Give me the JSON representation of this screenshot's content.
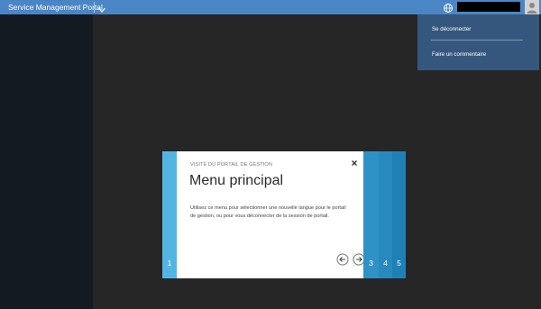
{
  "topbar": {
    "brand": "Service Management Portal",
    "colors": {
      "bar": "#4a86c5",
      "nav": "#141a22",
      "menu": "#36577d"
    }
  },
  "user_menu": {
    "items": [
      {
        "label": "Se déconnecter"
      },
      {
        "label": "Faire un commentaire"
      }
    ]
  },
  "tour": {
    "kicker": "VISITE DU PORTAIL DE GESTION",
    "title": "Menu principal",
    "description": "Utilisez ce menu pour sélectionner une nouvelle langue pour le portail de gestion, ou pour vous déconnecter de la session de portail.",
    "steps": [
      "1",
      "3",
      "4",
      "5"
    ],
    "icons": {
      "close": "close-icon",
      "prev": "arrow-left-icon",
      "next": "arrow-right-icon"
    }
  }
}
